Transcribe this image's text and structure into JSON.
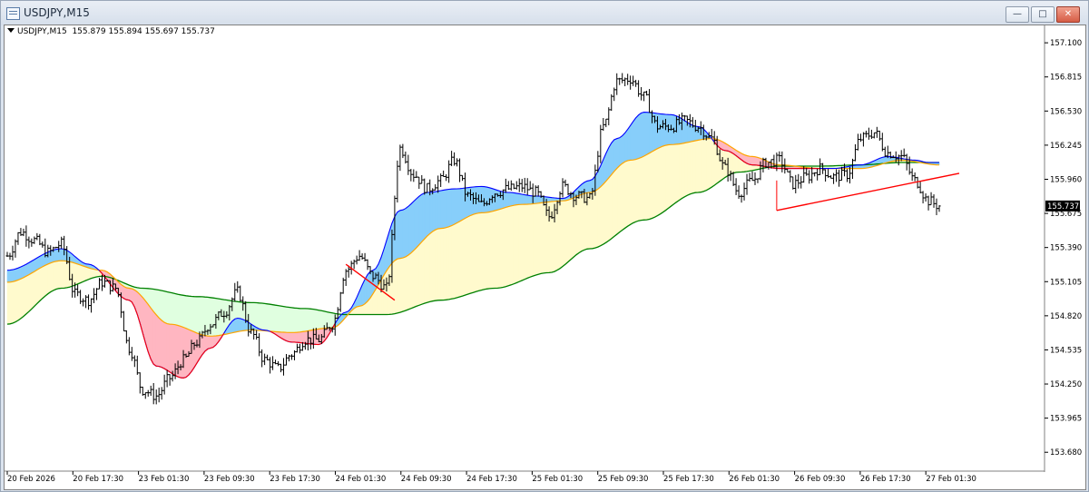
{
  "window": {
    "title": "USDJPY,M15",
    "buttons": {
      "minimize": "—",
      "maximize": "□",
      "close": "✕"
    }
  },
  "chart_info": {
    "symbol_period": "USDJPY,M15",
    "ohlc": "155.879 155.894 155.697 155.737"
  },
  "colors": {
    "ma_fast": "#0000ff",
    "ma_mid": "#ffa500",
    "ma_slow": "#008000",
    "cloud_up": "#ffb6c1",
    "cloud_down": "#87cefa",
    "cloud_long": "#fffacd",
    "cloud_long_down": "#e0ffe0",
    "trendline": "#ff0000",
    "candle": "#000000",
    "price_tag_bg": "#000000"
  },
  "chart_data": {
    "type": "candlestick",
    "symbol": "USDJPY",
    "timeframe": "M15",
    "last_price": "155.737",
    "ylim": [
      153.53,
      157.23
    ],
    "yticks": [
      "157.100",
      "156.815",
      "156.530",
      "156.245",
      "155.960",
      "155.675",
      "155.390",
      "155.105",
      "154.820",
      "154.535",
      "154.250",
      "153.965",
      "153.680"
    ],
    "xticks": [
      "20 Feb 2026",
      "20 Feb 17:30",
      "23 Feb 01:30",
      "23 Feb 09:30",
      "23 Feb 17:30",
      "24 Feb 01:30",
      "24 Feb 09:30",
      "24 Feb 17:30",
      "25 Feb 01:30",
      "25 Feb 09:30",
      "25 Feb 17:30",
      "26 Feb 01:30",
      "26 Feb 09:30",
      "26 Feb 17:30",
      "27 Feb 01:30"
    ],
    "x_range_bars": [
      0,
      344
    ],
    "price_path": [
      [
        0,
        155.32
      ],
      [
        5,
        155.52
      ],
      [
        10,
        155.45
      ],
      [
        15,
        155.35
      ],
      [
        20,
        155.42
      ],
      [
        25,
        155.0
      ],
      [
        30,
        154.95
      ],
      [
        35,
        155.1
      ],
      [
        40,
        155.05
      ],
      [
        45,
        154.55
      ],
      [
        50,
        154.2
      ],
      [
        55,
        154.15
      ],
      [
        60,
        154.3
      ],
      [
        65,
        154.45
      ],
      [
        70,
        154.6
      ],
      [
        75,
        154.75
      ],
      [
        80,
        154.85
      ],
      [
        85,
        155.02
      ],
      [
        90,
        154.68
      ],
      [
        95,
        154.45
      ],
      [
        100,
        154.38
      ],
      [
        105,
        154.5
      ],
      [
        110,
        154.62
      ],
      [
        115,
        154.62
      ],
      [
        120,
        154.75
      ],
      [
        125,
        155.2
      ],
      [
        130,
        155.32
      ],
      [
        135,
        155.15
      ],
      [
        140,
        155.05
      ],
      [
        145,
        156.22
      ],
      [
        150,
        156.0
      ],
      [
        155,
        155.88
      ],
      [
        160,
        155.95
      ],
      [
        165,
        156.12
      ],
      [
        170,
        155.82
      ],
      [
        175,
        155.75
      ],
      [
        180,
        155.85
      ],
      [
        185,
        155.88
      ],
      [
        190,
        155.9
      ],
      [
        195,
        155.85
      ],
      [
        200,
        155.65
      ],
      [
        205,
        155.9
      ],
      [
        210,
        155.82
      ],
      [
        215,
        155.8
      ],
      [
        220,
        156.4
      ],
      [
        225,
        156.78
      ],
      [
        230,
        156.8
      ],
      [
        235,
        156.65
      ],
      [
        240,
        156.4
      ],
      [
        245,
        156.4
      ],
      [
        250,
        156.45
      ],
      [
        255,
        156.4
      ],
      [
        260,
        156.3
      ],
      [
        265,
        156.05
      ],
      [
        270,
        155.85
      ],
      [
        275,
        155.95
      ],
      [
        280,
        156.1
      ],
      [
        285,
        156.12
      ],
      [
        290,
        155.92
      ],
      [
        295,
        155.98
      ],
      [
        300,
        156.05
      ],
      [
        305,
        155.98
      ],
      [
        310,
        156.0
      ],
      [
        315,
        156.3
      ],
      [
        320,
        156.35
      ],
      [
        325,
        156.18
      ],
      [
        330,
        156.15
      ],
      [
        335,
        155.95
      ],
      [
        340,
        155.78
      ],
      [
        344,
        155.737
      ]
    ],
    "ma_fast": [
      [
        0,
        155.2
      ],
      [
        20,
        155.38
      ],
      [
        30,
        155.25
      ],
      [
        45,
        154.95
      ],
      [
        55,
        154.4
      ],
      [
        65,
        154.3
      ],
      [
        75,
        154.55
      ],
      [
        85,
        154.8
      ],
      [
        95,
        154.7
      ],
      [
        105,
        154.6
      ],
      [
        115,
        154.58
      ],
      [
        125,
        154.85
      ],
      [
        135,
        155.2
      ],
      [
        145,
        155.7
      ],
      [
        155,
        155.85
      ],
      [
        165,
        155.88
      ],
      [
        175,
        155.9
      ],
      [
        185,
        155.85
      ],
      [
        195,
        155.82
      ],
      [
        205,
        155.8
      ],
      [
        215,
        155.95
      ],
      [
        225,
        156.3
      ],
      [
        235,
        156.52
      ],
      [
        245,
        156.5
      ],
      [
        255,
        156.4
      ],
      [
        265,
        156.2
      ],
      [
        275,
        156.08
      ],
      [
        285,
        156.05
      ],
      [
        295,
        156.05
      ],
      [
        305,
        156.05
      ],
      [
        315,
        156.08
      ],
      [
        325,
        156.15
      ],
      [
        335,
        156.12
      ],
      [
        340,
        156.1
      ],
      [
        344,
        156.1
      ]
    ],
    "ma_mid": [
      [
        0,
        155.1
      ],
      [
        20,
        155.28
      ],
      [
        35,
        155.2
      ],
      [
        45,
        155.05
      ],
      [
        60,
        154.75
      ],
      [
        75,
        154.65
      ],
      [
        90,
        154.7
      ],
      [
        105,
        154.68
      ],
      [
        120,
        154.72
      ],
      [
        130,
        154.9
      ],
      [
        145,
        155.3
      ],
      [
        160,
        155.55
      ],
      [
        175,
        155.68
      ],
      [
        190,
        155.75
      ],
      [
        205,
        155.78
      ],
      [
        215,
        155.85
      ],
      [
        230,
        156.12
      ],
      [
        245,
        156.25
      ],
      [
        260,
        156.3
      ],
      [
        275,
        156.15
      ],
      [
        285,
        156.08
      ],
      [
        300,
        156.05
      ],
      [
        315,
        156.05
      ],
      [
        330,
        156.12
      ],
      [
        344,
        156.08
      ]
    ],
    "ma_slow": [
      [
        0,
        154.75
      ],
      [
        20,
        155.05
      ],
      [
        35,
        155.15
      ],
      [
        50,
        155.05
      ],
      [
        70,
        154.98
      ],
      [
        90,
        154.93
      ],
      [
        110,
        154.88
      ],
      [
        125,
        154.83
      ],
      [
        140,
        154.83
      ],
      [
        160,
        154.95
      ],
      [
        180,
        155.05
      ],
      [
        200,
        155.18
      ],
      [
        215,
        155.38
      ],
      [
        235,
        155.62
      ],
      [
        255,
        155.85
      ],
      [
        270,
        156.02
      ],
      [
        285,
        156.07
      ],
      [
        300,
        156.07
      ],
      [
        315,
        156.08
      ],
      [
        330,
        156.1
      ],
      [
        344,
        156.1
      ]
    ],
    "cloud_fast_mid": {
      "description_colors": [
        "up: pink",
        "down: light blue"
      ]
    },
    "trendlines": [
      {
        "from": [
          284,
          155.7
        ],
        "to": [
          344,
          155.99
        ]
      },
      {
        "from": [
          125,
          155.25
        ],
        "to": [
          143,
          154.95
        ]
      }
    ]
  }
}
